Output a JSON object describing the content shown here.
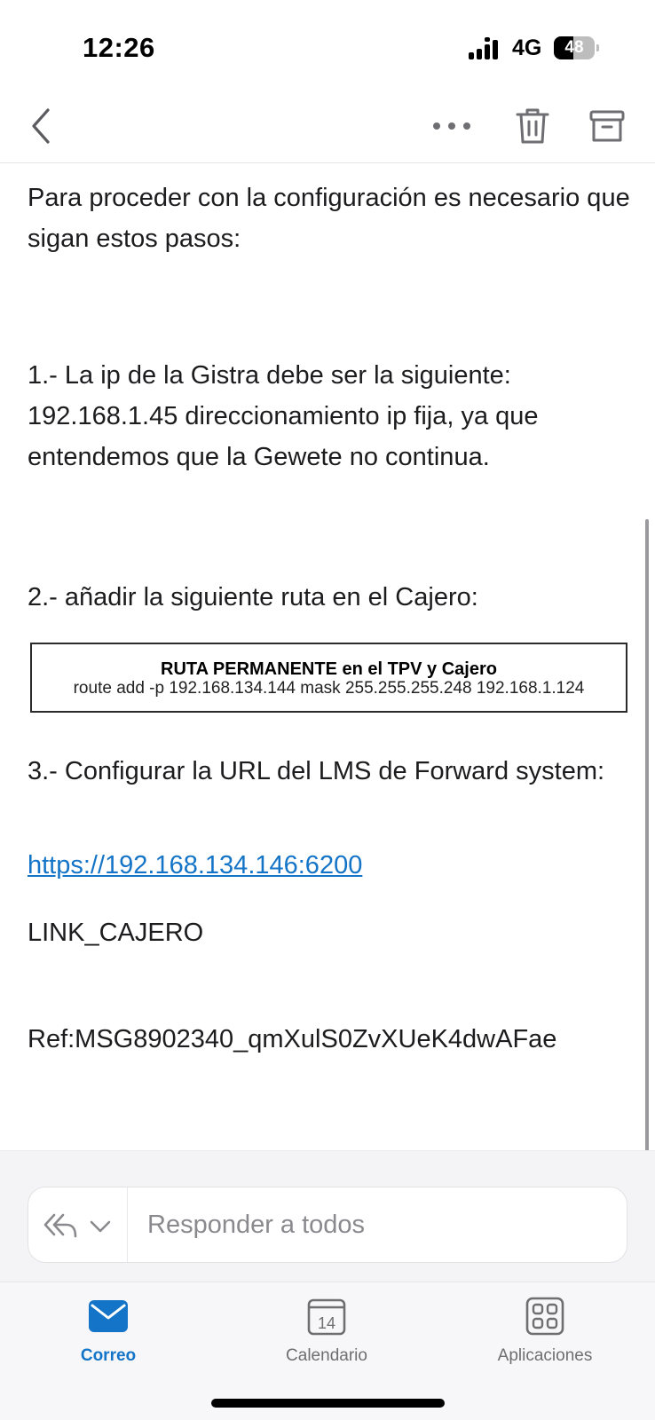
{
  "status_bar": {
    "time": "12:26",
    "network": "4G",
    "battery_percent": 48,
    "battery_label": "48"
  },
  "nav": {
    "back_icon": "chevron-left-icon",
    "more_icon": "ellipsis-icon",
    "delete_icon": "trash-icon",
    "archive_icon": "archive-box-icon"
  },
  "email": {
    "intro": "Para proceder con la configuración es necesario que sigan estos pasos:",
    "step1": "1.- La ip de la Gistra debe ser la siguiente: 192.168.1.45 direccionamiento ip fija, ya que entendemos que la Gewete no continua.",
    "step2": "2.- añadir la siguiente ruta en el Cajero:",
    "route_box": {
      "title": "RUTA PERMANENTE en el TPV y Cajero",
      "command": "route add -p 192.168.134.144 mask 255.255.255.248 192.168.1.124"
    },
    "step3": "3.- Configurar la URL del LMS de Forward system:",
    "link": "https://192.168.134.146:6200",
    "token": "LINK_CAJERO",
    "ref": "Ref:MSG8902340_qmXulS0ZvXUeK4dwAFae"
  },
  "reply": {
    "placeholder": "Responder a todos",
    "reply_all_icon": "reply-all-icon",
    "chevron_icon": "chevron-down-icon"
  },
  "tabs": [
    {
      "label": "Correo",
      "icon": "mail-icon",
      "active": true
    },
    {
      "label": "Calendario",
      "icon": "calendar-icon",
      "day": "14",
      "active": false
    },
    {
      "label": "Aplicaciones",
      "icon": "apps-grid-icon",
      "active": false
    }
  ],
  "colors": {
    "accent": "#1474c7",
    "text": "#1c1c1e",
    "inactive": "#6e6e73"
  }
}
